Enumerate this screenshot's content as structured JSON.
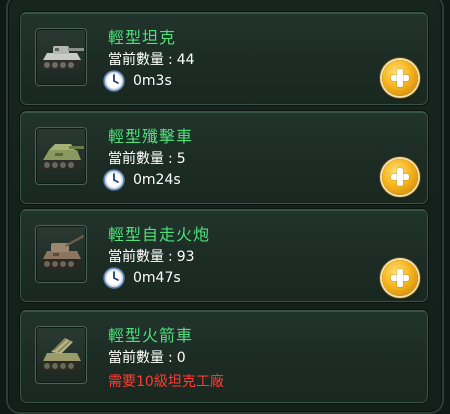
{
  "units": [
    {
      "name": "輕型坦克",
      "count_label": "當前數量",
      "count_sep": ":",
      "count": "44",
      "time": "0m3s",
      "requirement": null,
      "thumb_icon": "light-tank-icon",
      "has_add_button": true
    },
    {
      "name": "輕型殲擊車",
      "count_label": "當前數量",
      "count_sep": ":",
      "count": "5",
      "time": "0m24s",
      "requirement": null,
      "thumb_icon": "tank-destroyer-icon",
      "has_add_button": true
    },
    {
      "name": "輕型自走火炮",
      "count_label": "當前數量",
      "count_sep": ":",
      "count": "93",
      "time": "0m47s",
      "requirement": null,
      "thumb_icon": "self-propelled-artillery-icon",
      "has_add_button": true
    },
    {
      "name": "輕型火箭車",
      "count_label": "當前數量",
      "count_sep": ":",
      "count": "0",
      "time": null,
      "requirement": "需要10級坦克工廠",
      "thumb_icon": "rocket-launcher-vehicle-icon",
      "has_add_button": false
    }
  ],
  "colors": {
    "name": "#4fe07a",
    "requirement": "#ff3b33",
    "button": "#f6b41c"
  }
}
